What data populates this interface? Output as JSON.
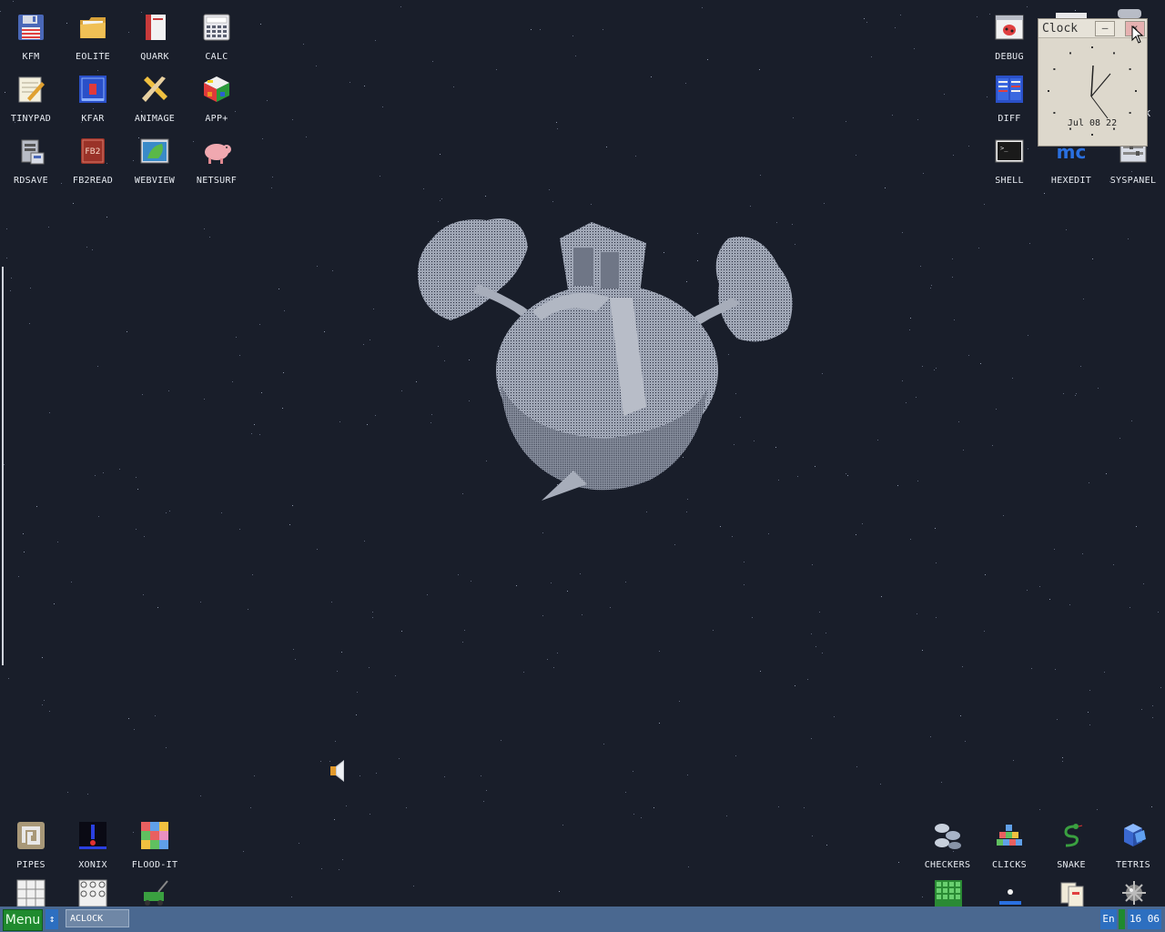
{
  "desktop": {
    "icons": [
      {
        "name": "kfm-icon",
        "label": "KFM"
      },
      {
        "name": "eolite-icon",
        "label": "EOLITE"
      },
      {
        "name": "quark-icon",
        "label": "QUARK"
      },
      {
        "name": "calc-icon",
        "label": "CALC"
      },
      {
        "name": "tinypad-icon",
        "label": "TINYPAD"
      },
      {
        "name": "kfar-icon",
        "label": "KFAR"
      },
      {
        "name": "animage-icon",
        "label": "ANIMAGE"
      },
      {
        "name": "app-plus-icon",
        "label": "APP+"
      },
      {
        "name": "rdsave-icon",
        "label": "RDSAVE"
      },
      {
        "name": "fb2read-icon",
        "label": "FB2READ"
      },
      {
        "name": "webview-icon",
        "label": "WEBVIEW"
      },
      {
        "name": "netsurf-icon",
        "label": "NETSURF"
      },
      {
        "name": "debug-icon",
        "label": "DEBUG"
      },
      {
        "name": "diff-icon",
        "label": "DIFF"
      },
      {
        "name": "shell-icon",
        "label": "SHELL"
      },
      {
        "name": "hexedit-icon",
        "label": "HEXEDIT"
      },
      {
        "name": "syspanel-icon",
        "label": "SYSPANEL"
      },
      {
        "name": "pipes-icon",
        "label": "PIPES"
      },
      {
        "name": "xonix-icon",
        "label": "XONIX"
      },
      {
        "name": "flood-it-icon",
        "label": "FLOOD-IT"
      },
      {
        "name": "checkers-icon",
        "label": "CHECKERS"
      },
      {
        "name": "clicks-icon",
        "label": "CLICKS"
      },
      {
        "name": "snake-icon",
        "label": "SNAKE"
      },
      {
        "name": "tetris-icon",
        "label": "TETRIS"
      }
    ],
    "partial_label": "K",
    "fb2_badge": "FB2",
    "mc_badge": "mc"
  },
  "clock": {
    "title": "Clock",
    "minimize": "–",
    "close": "×",
    "date": "Jul 08 22"
  },
  "taskbar": {
    "menu": "Menu",
    "arrow": "↕",
    "task": "ACLOCK",
    "lang": "En",
    "time": "16 06"
  },
  "colors": {
    "desktop": "#191e2a",
    "taskbar": "#4a6890",
    "menu": "#1f8a2e",
    "accent": "#2d6fc0"
  }
}
